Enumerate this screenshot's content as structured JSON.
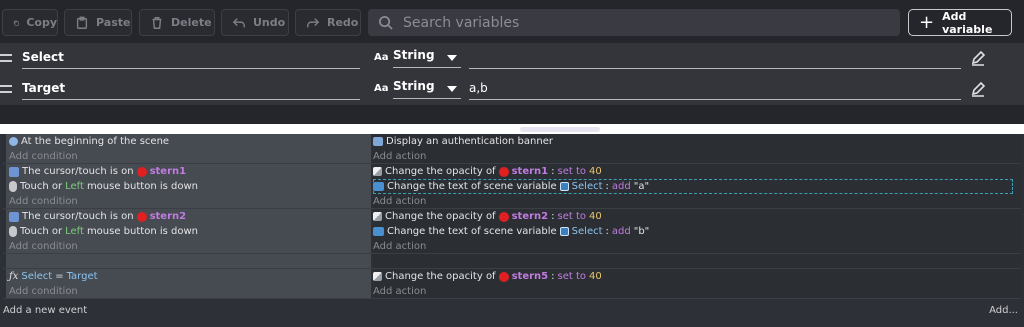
{
  "toolbar": {
    "copy": "Copy",
    "paste": "Paste",
    "delete": "Delete",
    "undo": "Undo",
    "redo": "Redo",
    "search_placeholder": "Search variables",
    "add_variable": "Add variable"
  },
  "variables": [
    {
      "name": "Select",
      "type": "String",
      "type_icon": "Aa",
      "value": ""
    },
    {
      "name": "Target",
      "type": "String",
      "type_icon": "Aa",
      "value": "a,b"
    }
  ],
  "events": {
    "add_condition": "Add condition",
    "add_action": "Add action",
    "list": [
      {
        "conditions": [
          {
            "icon": "scene-start-icon",
            "parts": [
              {
                "t": "At the beginning of the scene",
                "c": "str"
              }
            ]
          }
        ],
        "actions": [
          {
            "icon": "user-icon",
            "parts": [
              {
                "t": "Display an authentication banner",
                "c": "str"
              }
            ]
          }
        ]
      },
      {
        "conditions": [
          {
            "icon": "cursor-icon",
            "parts": [
              {
                "t": "The cursor/touch is on ",
                "c": "str"
              },
              {
                "t": "stern1",
                "c": "obj",
                "dot": true
              }
            ]
          },
          {
            "icon": "mouse-icon",
            "parts": [
              {
                "t": "Touch or ",
                "c": "str"
              },
              {
                "t": "Left",
                "c": "kw"
              },
              {
                "t": " mouse button is down",
                "c": "str"
              }
            ]
          }
        ],
        "actions": [
          {
            "icon": "opacity-icon",
            "parts": [
              {
                "t": "Change the opacity of ",
                "c": "str"
              },
              {
                "t": "stern1",
                "c": "obj",
                "dot": true
              },
              {
                "t": ": ",
                "c": "str"
              },
              {
                "t": "set to",
                "c": "eq"
              },
              {
                "t": " 40",
                "c": "num"
              }
            ]
          },
          {
            "icon": "text-icon",
            "selected": true,
            "parts": [
              {
                "t": "Change the text of scene variable ",
                "c": "str"
              },
              {
                "t": "Select",
                "c": "var",
                "varicon": true
              },
              {
                "t": ": ",
                "c": "str"
              },
              {
                "t": "add",
                "c": "eq"
              },
              {
                "t": " \"a\"",
                "c": "str"
              }
            ]
          }
        ]
      },
      {
        "conditions": [
          {
            "icon": "cursor-icon",
            "parts": [
              {
                "t": "The cursor/touch is on ",
                "c": "str"
              },
              {
                "t": "stern2",
                "c": "obj",
                "dot": true
              }
            ]
          },
          {
            "icon": "mouse-icon",
            "parts": [
              {
                "t": "Touch or ",
                "c": "str"
              },
              {
                "t": "Left",
                "c": "kw"
              },
              {
                "t": " mouse button is down",
                "c": "str"
              }
            ]
          }
        ],
        "actions": [
          {
            "icon": "opacity-icon",
            "parts": [
              {
                "t": "Change the opacity of ",
                "c": "str"
              },
              {
                "t": "stern2",
                "c": "obj",
                "dot": true
              },
              {
                "t": ": ",
                "c": "str"
              },
              {
                "t": "set to",
                "c": "eq"
              },
              {
                "t": " 40",
                "c": "num"
              }
            ]
          },
          {
            "icon": "text-icon",
            "parts": [
              {
                "t": "Change the text of scene variable ",
                "c": "str"
              },
              {
                "t": "Select",
                "c": "var",
                "varicon": true
              },
              {
                "t": ": ",
                "c": "str"
              },
              {
                "t": "add",
                "c": "eq"
              },
              {
                "t": " \"b\"",
                "c": "str"
              }
            ]
          }
        ]
      },
      {
        "empty": true
      },
      {
        "conditions": [
          {
            "icon": "fx-icon",
            "parts": [
              {
                "t": "Select",
                "c": "var"
              },
              {
                "t": " = ",
                "c": "str"
              },
              {
                "t": "Target",
                "c": "var"
              }
            ]
          }
        ],
        "actions": [
          {
            "icon": "opacity-icon",
            "parts": [
              {
                "t": "Change the opacity of ",
                "c": "str"
              },
              {
                "t": "stern5",
                "c": "obj",
                "dot": true
              },
              {
                "t": ": ",
                "c": "str"
              },
              {
                "t": "set to",
                "c": "eq"
              },
              {
                "t": " 40",
                "c": "num"
              }
            ]
          }
        ]
      }
    ],
    "add_event": "Add a new event",
    "add_right": "Add..."
  }
}
